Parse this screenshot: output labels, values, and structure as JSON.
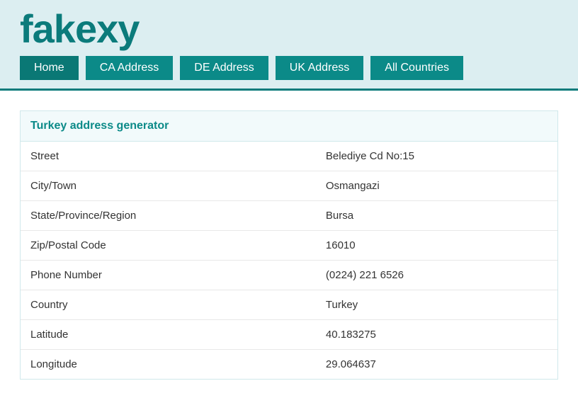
{
  "header": {
    "logo": "fakexy",
    "nav": [
      {
        "label": "Home",
        "active": true
      },
      {
        "label": "CA Address",
        "active": false
      },
      {
        "label": "DE Address",
        "active": false
      },
      {
        "label": "UK Address",
        "active": false
      },
      {
        "label": "All Countries",
        "active": false
      }
    ]
  },
  "panel": {
    "title": "Turkey address generator",
    "rows": [
      {
        "label": "Street",
        "value": "Belediye Cd No:15"
      },
      {
        "label": "City/Town",
        "value": "Osmangazi"
      },
      {
        "label": "State/Province/Region",
        "value": "Bursa"
      },
      {
        "label": "Zip/Postal Code",
        "value": "16010"
      },
      {
        "label": "Phone Number",
        "value": "(0224) 221 6526"
      },
      {
        "label": "Country",
        "value": "Turkey"
      },
      {
        "label": "Latitude",
        "value": "40.183275"
      },
      {
        "label": "Longitude",
        "value": "29.064637"
      }
    ]
  }
}
